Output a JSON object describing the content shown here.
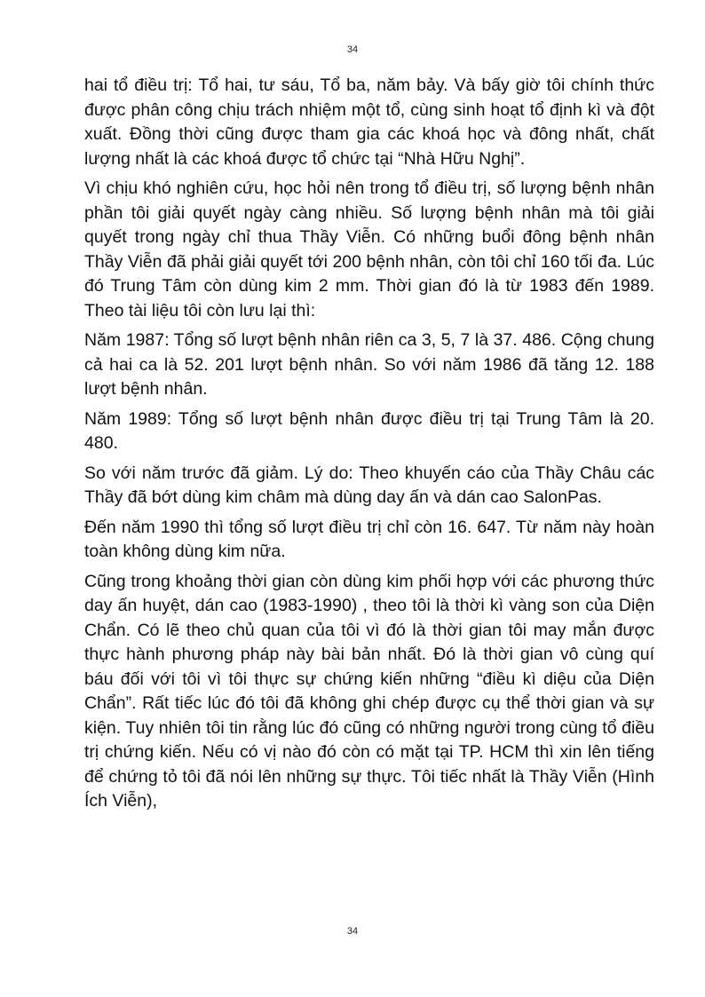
{
  "page_number_top": "34",
  "page_number_bottom": "34",
  "paragraphs": [
    "hai tổ điều trị: Tổ hai, tư sáu, Tổ ba, năm bảy. Và bấy giờ tôi chính thức được phân công chịu trách nhiệm một tổ, cùng sinh hoạt tổ định kì và đột xuất. Đồng thời cũng được tham gia các khoá học và đông nhất, chất lượng nhất là các khoá được tổ chức tại “Nhà Hữu Nghị”.",
    "Vì chịu khó nghiên cứu, học hỏi nên trong tổ điều trị, số lượng bệnh nhân phần tôi giải quyết ngày càng nhiều. Số lượng bệnh nhân mà tôi giải quyết trong ngày chỉ thua Thầy Viễn. Có những buổi đông bệnh nhân Thầy Viễn đã phải giải quyết tới 200 bệnh nhân, còn tôi chỉ 160 tối đa. Lúc đó Trung Tâm còn dùng kim 2 mm. Thời gian đó là từ 1983 đến 1989. Theo tài liệu tôi còn lưu lại thì:",
    "Năm 1987: Tổng số lượt bệnh nhân riên ca 3, 5, 7 là 37. 486. Cộng chung cả hai ca là 52. 201 lượt bệnh nhân. So với năm 1986 đã tăng 12. 188 lượt bệnh nhân.",
    "Năm 1989: Tổng số lượt bệnh nhân được điều trị tại Trung Tâm là 20. 480.",
    " So với năm trước đã giảm. Lý do: Theo khuyến cáo của Thầy Châu các Thầy đã bớt dùng kim châm mà dùng day ấn và dán cao SalonPas.",
    "Đến năm 1990 thì tổng số lượt điều trị chỉ còn 16. 647. Từ năm này hoàn toàn không dùng kim nữa.",
    "Cũng trong khoảng thời gian còn dùng kim phối hợp với các phương thức day ấn huyệt, dán cao (1983-1990) , theo tôi là thời kì vàng son của Diện Chẩn. Có lẽ theo chủ quan của tôi vì đó là thời gian tôi may mắn được thực hành phương pháp này bài bản nhất. Đó là thời gian vô cùng quí báu đối với tôi vì tôi thực sự chứng kiến những “điều kì diệu của Diện Chẩn”. Rất tiếc lúc đó tôi đã không ghi chép được cụ thể thời gian và sự kiện. Tuy nhiên tôi tin rằng lúc đó cũng có những người trong cùng tổ điều trị chứng kiến. Nếu có vị nào đó còn có mặt tại TP. HCM thì xin lên tiếng để chứng tỏ tôi đã nói lên những sự thực. Tôi tiếc nhất là Thầy Viễn (Hình Ích Viễn),"
  ]
}
